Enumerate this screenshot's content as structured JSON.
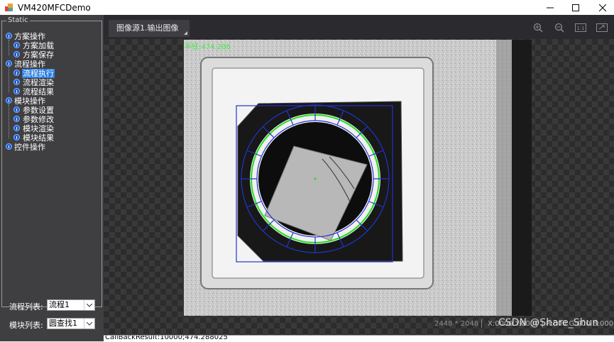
{
  "window": {
    "title": "VM420MFCDemo"
  },
  "group_box": {
    "caption": "Static"
  },
  "tree": [
    {
      "label": "方案操作",
      "level": 0
    },
    {
      "label": "方案加载",
      "level": 1
    },
    {
      "label": "方案保存",
      "level": 1
    },
    {
      "label": "流程操作",
      "level": 0
    },
    {
      "label": "流程执行",
      "level": 1,
      "selected": true
    },
    {
      "label": "流程渲染",
      "level": 1
    },
    {
      "label": "流程结果",
      "level": 1
    },
    {
      "label": "模块操作",
      "level": 0
    },
    {
      "label": "参数设置",
      "level": 1
    },
    {
      "label": "参数修改",
      "level": 1
    },
    {
      "label": "模块渲染",
      "level": 1
    },
    {
      "label": "模块结果",
      "level": 1
    },
    {
      "label": "控件操作",
      "level": 0
    }
  ],
  "process_list": {
    "label": "流程列表:",
    "value": "流程1"
  },
  "module_list": {
    "label": "模块列表:",
    "value": "圆查找1"
  },
  "viewer": {
    "tab_label": "图像源1.输出图像",
    "radius_text": "半径:474.288",
    "image_size": "2448 * 2048",
    "pixel_info": "X:0000  Y:0000  |  R:000  G:000  B:000",
    "watermark": "CSDN @Share_Shun",
    "tools": [
      "zoom-in-icon",
      "zoom-out-icon",
      "actual-size-icon",
      "fit-window-icon"
    ]
  },
  "callback_result": "CallBackResult:10000;474.288025",
  "colors": {
    "selection": "#2f7fe0",
    "radius_text": "#46e846",
    "caliper": "#2233cc",
    "fit_circle": "#22dd22"
  }
}
